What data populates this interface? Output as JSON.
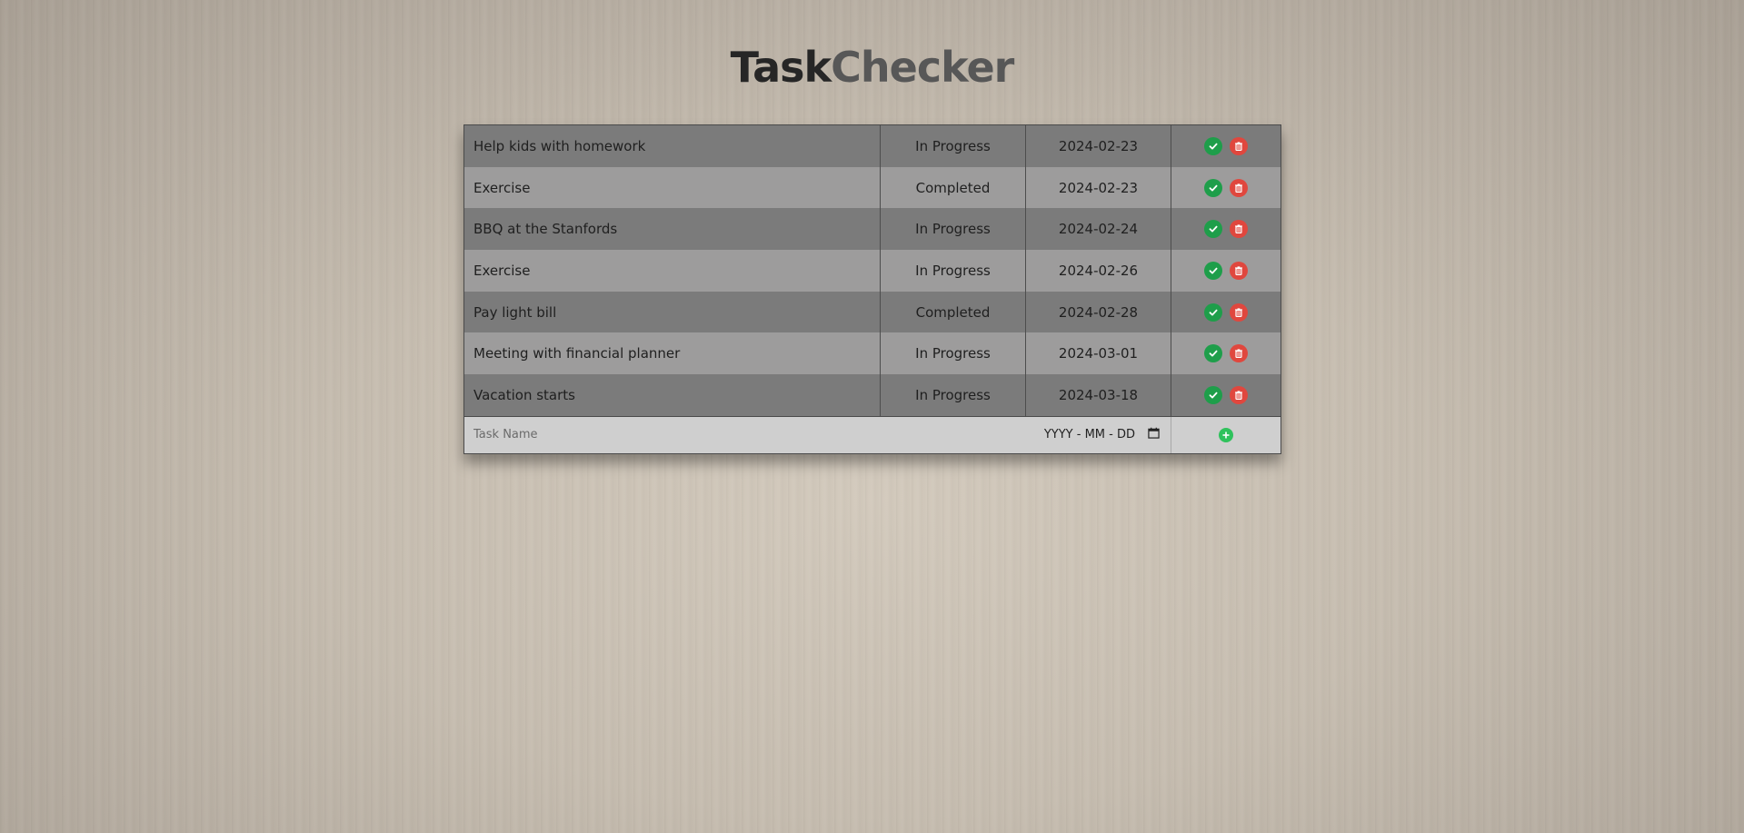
{
  "app": {
    "title_part1": "Task",
    "title_part2": "Checker"
  },
  "tasks": [
    {
      "name": "Help kids with homework",
      "status": "In Progress",
      "date": "2024-02-23"
    },
    {
      "name": "Exercise",
      "status": "Completed",
      "date": "2024-02-23"
    },
    {
      "name": "BBQ at the Stanfords",
      "status": "In Progress",
      "date": "2024-02-24"
    },
    {
      "name": "Exercise",
      "status": "In Progress",
      "date": "2024-02-26"
    },
    {
      "name": "Pay light bill",
      "status": "Completed",
      "date": "2024-02-28"
    },
    {
      "name": "Meeting with financial planner",
      "status": "In Progress",
      "date": "2024-03-01"
    },
    {
      "name": "Vacation starts",
      "status": "In Progress",
      "date": "2024-03-18"
    }
  ],
  "new_task": {
    "name_placeholder": "Task Name",
    "date_placeholder": "YYYY - MM - DD"
  },
  "icons": {
    "complete": "check-circle-icon",
    "delete": "trash-icon",
    "calendar": "calendar-icon",
    "add": "plus-circle-icon"
  },
  "colors": {
    "complete_button": "#1e9e4a",
    "delete_button": "#e0473e",
    "add_button": "#2fc25c"
  }
}
